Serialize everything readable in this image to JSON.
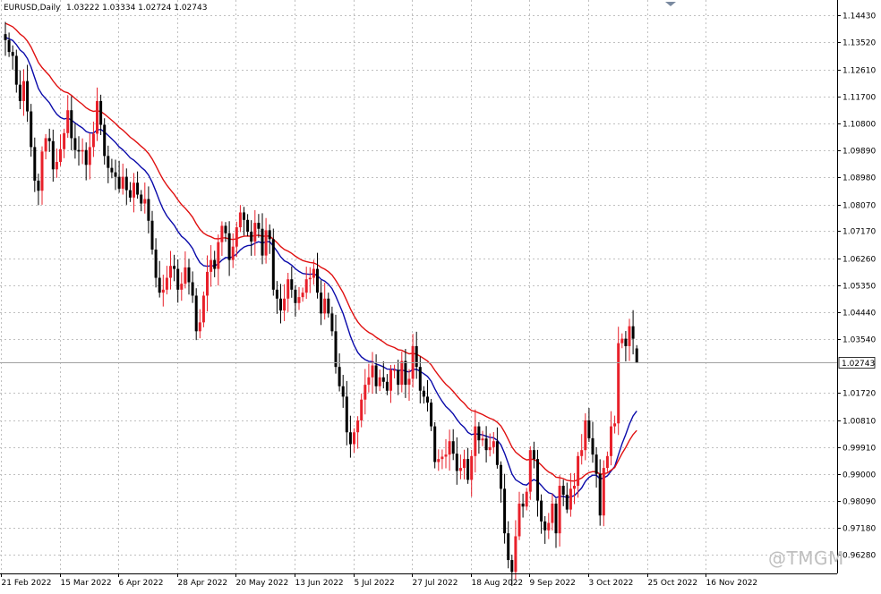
{
  "chart_data": {
    "type": "candlestick",
    "title": "EURUSD,Daily",
    "ohlc_label": "1.03222 1.03334 1.02724 1.02743",
    "last_price_label": "1.02743",
    "last_price": 1.02743,
    "ylim": [
      0.9565,
      1.1495
    ],
    "y_ticks": [
      1.1443,
      1.1352,
      1.1261,
      1.117,
      1.108,
      1.0989,
      1.0898,
      1.0807,
      1.0717,
      1.0626,
      1.0535,
      1.0444,
      1.0354,
      1.0172,
      1.0081,
      0.9991,
      0.99,
      0.9809,
      0.9718,
      0.9628
    ],
    "y_tick_labels": [
      "1.14430",
      "1.13520",
      "1.12610",
      "1.11700",
      "1.10800",
      "1.09890",
      "1.08980",
      "1.08070",
      "1.07170",
      "1.06260",
      "1.05350",
      "1.04440",
      "1.03540",
      "1.01720",
      "1.00810",
      "0.99910",
      "0.99000",
      "0.98090",
      "0.97180",
      "0.96280"
    ],
    "x_labels": [
      "21 Feb 2022",
      "15 Mar 2022",
      "6 Apr 2022",
      "28 Apr 2022",
      "20 May 2022",
      "13 Jun 2022",
      "5 Jul 2022",
      "27 Jul 2022",
      "18 Aug 2022",
      "9 Sep 2022",
      "3 Oct 2022",
      "25 Oct 2022",
      "16 Nov 2022"
    ],
    "grid": true,
    "colors": {
      "bull": "#e8202a",
      "bear": "#000000",
      "ma_fast": "#0a0aaa",
      "ma_slow": "#e01010",
      "grid": "#c0c0c0",
      "price_line": "#a0a0a0"
    },
    "closes": [
      1.136,
      1.132,
      1.1307,
      1.121,
      1.1155,
      1.1222,
      1.112,
      1.1,
      1.0887,
      1.0853,
      1.0985,
      1.103,
      1.102,
      1.0925,
      1.095,
      1.0993,
      1.1047,
      1.1124,
      1.103,
      1.099,
      1.0985,
      1.099,
      1.094,
      1.1,
      1.1045,
      1.1155,
      1.1075,
      1.097,
      1.093,
      1.0915,
      1.09,
      1.086,
      1.09,
      1.0855,
      1.083,
      1.088,
      1.084,
      1.081,
      1.0825,
      1.0752,
      1.0655,
      1.056,
      1.051,
      1.052,
      1.056,
      1.06,
      1.059,
      1.052,
      1.054,
      1.0595,
      1.0545,
      1.05,
      1.038,
      1.041,
      1.05,
      1.058,
      1.062,
      1.059,
      1.068,
      1.0735,
      1.071,
      1.062,
      1.0665,
      1.073,
      1.078,
      1.0755,
      1.0715,
      1.0682,
      1.0745,
      1.0725,
      1.0635,
      1.072,
      1.069,
      1.052,
      1.049,
      1.045,
      1.049,
      1.0555,
      1.052,
      1.0475,
      1.0495,
      1.051,
      1.0555,
      1.056,
      1.059,
      1.051,
      1.044,
      1.049,
      1.044,
      1.038,
      1.026,
      1.0195,
      1.016,
      1.004,
      1.0,
      1.004,
      1.008,
      1.015,
      1.02,
      1.0225,
      1.0265,
      1.0195,
      1.0225,
      1.021,
      1.018,
      1.025,
      1.025,
      1.02,
      1.028,
      1.02,
      1.022,
      1.033,
      1.026,
      1.018,
      1.016,
      1.014,
      1.006,
      0.994,
      0.995,
      0.9958,
      0.9965,
      1.001,
      0.9968,
      0.991,
      0.992,
      0.995,
      0.988,
      0.996,
      1.006,
      1.0013,
      1.0019,
      0.998,
      0.999,
      1.001,
      0.993,
      0.985,
      0.97,
      0.961,
      0.957,
      0.969,
      0.98,
      0.979,
      0.984,
      0.998,
      0.995,
      0.981,
      0.974,
      0.971,
      0.9735,
      0.98,
      0.97,
      0.986,
      0.983,
      0.978,
      0.985,
      0.986,
      0.996,
      0.998,
      1.008,
      1.002,
      0.9965,
      0.99,
      0.976,
      0.992,
      0.996,
      1.006,
      1.007,
      1.034,
      1.0355,
      1.033,
      1.0397,
      1.0355,
      1.0274
    ]
  }
}
